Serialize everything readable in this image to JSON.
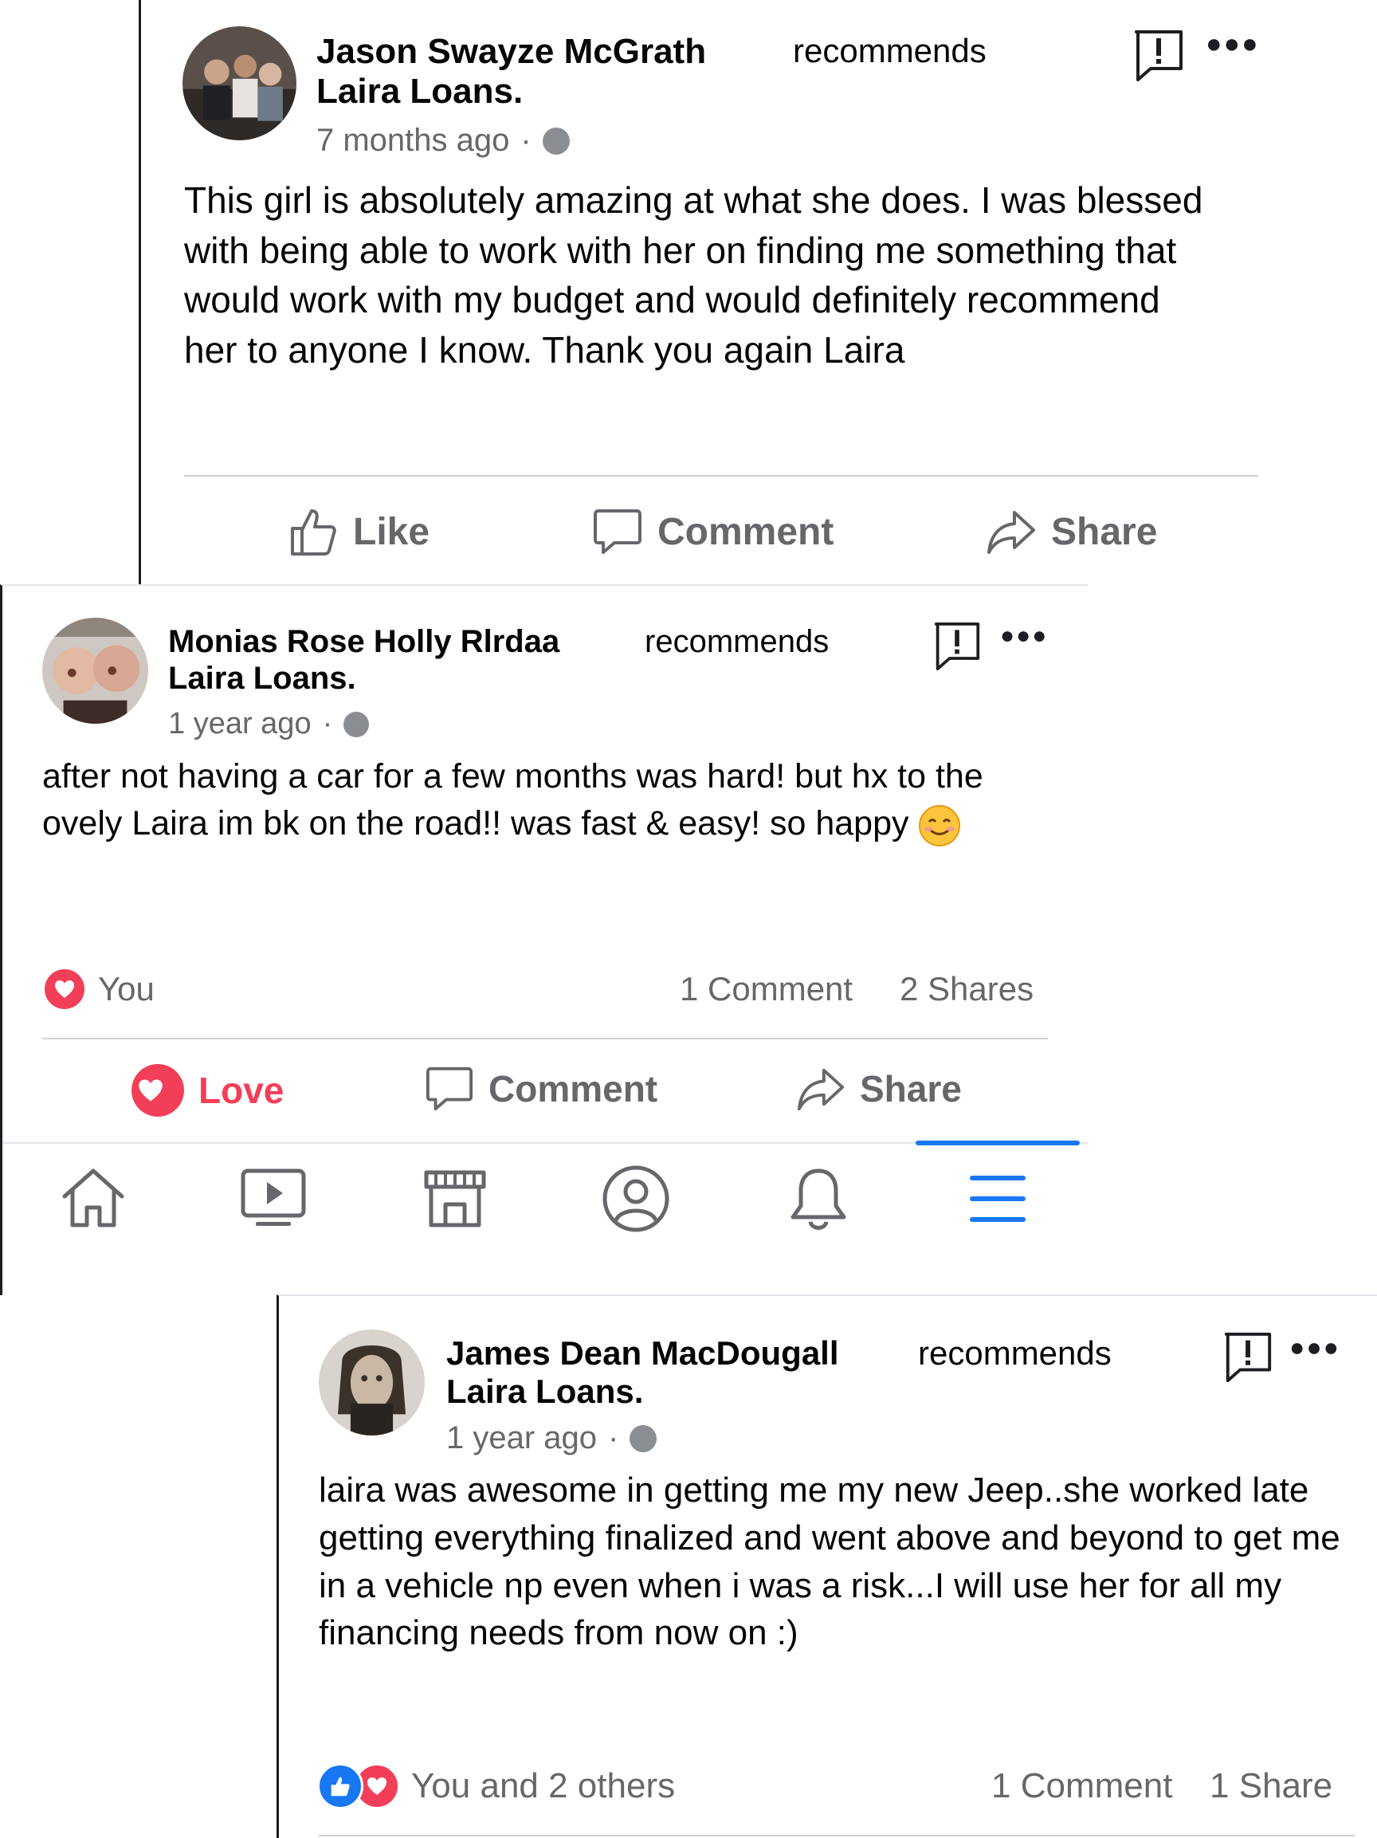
{
  "posts": [
    {
      "author": "Jason Swayze McGrath",
      "verb": "recommends",
      "page": "Laira Loans.",
      "time": "7 months ago",
      "separator": "·",
      "body": "This girl is absolutely amazing at what she does. I was blessed with being able to work with her on finding me something that would work with my budget and would definitely recommend her to anyone I know. Thank you again Laira",
      "actions": {
        "like": "Like",
        "comment": "Comment",
        "share": "Share"
      }
    },
    {
      "author": "Monias Rose Holly Rlrdaa",
      "verb": "recommends",
      "page": "Laira Loans.",
      "time": "1 year ago",
      "separator": "·",
      "body": "after not having a car for a few months was hard! but hx to the ovely Laira im bk on the road!! was fast & easy! so happy",
      "emoji": "smiling-face-emoji",
      "reactions_label": "You",
      "comments_count": "1 Comment",
      "shares_count": "2 Shares",
      "actions": {
        "love": "Love",
        "comment": "Comment",
        "share": "Share"
      }
    },
    {
      "author": "James Dean MacDougall",
      "verb": "recommends",
      "page": "Laira Loans.",
      "time": "1 year ago",
      "separator": "·",
      "body": "laira was awesome in getting me my new Jeep..she worked late getting everything finalized and went above and beyond to get me in a vehicle np even when i was a risk...I will use her for all my financing needs from now on :)",
      "reactions_label": "You and 2 others",
      "comments_count": "1 Comment",
      "shares_count": "1 Share"
    }
  ],
  "tab_bar": {
    "items": [
      "home-icon",
      "watch-icon",
      "marketplace-icon",
      "profile-icon",
      "notifications-icon",
      "menu-icon"
    ],
    "active": "menu-icon"
  },
  "colors": {
    "accent": "#1877f2",
    "love": "#f33e58",
    "muted": "#65676b",
    "divider": "#ced0d4"
  }
}
